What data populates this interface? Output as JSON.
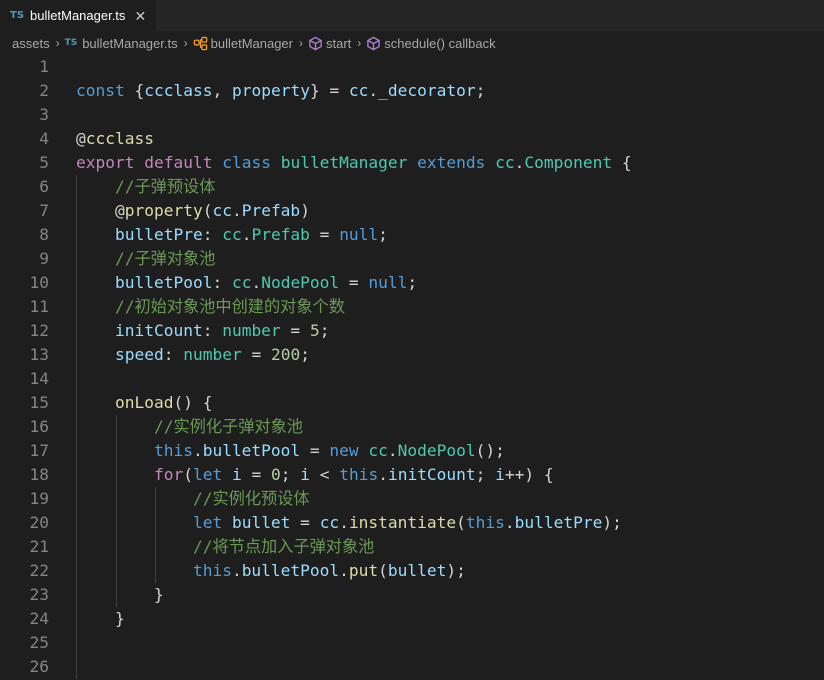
{
  "tab": {
    "badge": "TS",
    "label": "bulletManager.ts",
    "close": "✕"
  },
  "breadcrumb": {
    "folder": "assets",
    "file_badge": "TS",
    "file": "bulletManager.ts",
    "class_name": "bulletManager",
    "method": "start",
    "callback": "schedule() callback",
    "separator": "›"
  },
  "colors": {
    "background": "#1e1e1e",
    "tabbar": "#252526",
    "keyword": "#569cd6",
    "control": "#c586c0",
    "variable": "#9cdcfe",
    "type": "#4ec9b0",
    "function": "#dcdcaa",
    "number": "#b5cea8",
    "comment": "#6a9955",
    "line_number": "#858585",
    "ts_badge": "#519aba"
  },
  "icons": {
    "class_icon": "symbol-class-icon",
    "method_icon": "symbol-method-icon",
    "close_icon": "close-icon"
  },
  "lines": [
    {
      "n": "1",
      "tokens": []
    },
    {
      "n": "2",
      "tokens": [
        [
          "kw",
          "const"
        ],
        [
          "pl",
          " {"
        ],
        [
          "var",
          "ccclass"
        ],
        [
          "pl",
          ", "
        ],
        [
          "var",
          "property"
        ],
        [
          "pl",
          "} = "
        ],
        [
          "var",
          "cc"
        ],
        [
          "pl",
          "."
        ],
        [
          "var",
          "_decorator"
        ],
        [
          "pl",
          ";"
        ]
      ]
    },
    {
      "n": "3",
      "tokens": []
    },
    {
      "n": "4",
      "tokens": [
        [
          "pl",
          "@"
        ],
        [
          "fn",
          "ccclass"
        ]
      ]
    },
    {
      "n": "5",
      "tokens": [
        [
          "ctl",
          "export"
        ],
        [
          "pl",
          " "
        ],
        [
          "ctl",
          "default"
        ],
        [
          "pl",
          " "
        ],
        [
          "kw",
          "class"
        ],
        [
          "pl",
          " "
        ],
        [
          "type",
          "bulletManager"
        ],
        [
          "pl",
          " "
        ],
        [
          "kw",
          "extends"
        ],
        [
          "pl",
          " "
        ],
        [
          "type",
          "cc"
        ],
        [
          "pl",
          "."
        ],
        [
          "type",
          "Component"
        ],
        [
          "pl",
          " {"
        ]
      ]
    },
    {
      "n": "6",
      "tokens": [
        [
          "pl",
          "    "
        ],
        [
          "cm",
          "//子弹预设体"
        ]
      ]
    },
    {
      "n": "7",
      "tokens": [
        [
          "pl",
          "    @"
        ],
        [
          "fn",
          "property"
        ],
        [
          "pl",
          "("
        ],
        [
          "var",
          "cc"
        ],
        [
          "pl",
          "."
        ],
        [
          "var",
          "Prefab"
        ],
        [
          "pl",
          ")"
        ]
      ]
    },
    {
      "n": "8",
      "tokens": [
        [
          "pl",
          "    "
        ],
        [
          "var",
          "bulletPre"
        ],
        [
          "pl",
          ": "
        ],
        [
          "type",
          "cc"
        ],
        [
          "pl",
          "."
        ],
        [
          "type",
          "Prefab"
        ],
        [
          "pl",
          " = "
        ],
        [
          "kw",
          "null"
        ],
        [
          "pl",
          ";"
        ]
      ]
    },
    {
      "n": "9",
      "tokens": [
        [
          "pl",
          "    "
        ],
        [
          "cm",
          "//子弹对象池"
        ]
      ]
    },
    {
      "n": "10",
      "tokens": [
        [
          "pl",
          "    "
        ],
        [
          "var",
          "bulletPool"
        ],
        [
          "pl",
          ": "
        ],
        [
          "type",
          "cc"
        ],
        [
          "pl",
          "."
        ],
        [
          "type",
          "NodePool"
        ],
        [
          "pl",
          " = "
        ],
        [
          "kw",
          "null"
        ],
        [
          "pl",
          ";"
        ]
      ]
    },
    {
      "n": "11",
      "tokens": [
        [
          "pl",
          "    "
        ],
        [
          "cm",
          "//初始对象池中创建的对象个数"
        ]
      ]
    },
    {
      "n": "12",
      "tokens": [
        [
          "pl",
          "    "
        ],
        [
          "var",
          "initCount"
        ],
        [
          "pl",
          ": "
        ],
        [
          "type",
          "number"
        ],
        [
          "pl",
          " = "
        ],
        [
          "num",
          "5"
        ],
        [
          "pl",
          ";"
        ]
      ]
    },
    {
      "n": "13",
      "tokens": [
        [
          "pl",
          "    "
        ],
        [
          "var",
          "speed"
        ],
        [
          "pl",
          ": "
        ],
        [
          "type",
          "number"
        ],
        [
          "pl",
          " = "
        ],
        [
          "num",
          "200"
        ],
        [
          "pl",
          ";"
        ]
      ]
    },
    {
      "n": "14",
      "tokens": []
    },
    {
      "n": "15",
      "tokens": [
        [
          "pl",
          "    "
        ],
        [
          "fn",
          "onLoad"
        ],
        [
          "pl",
          "() {"
        ]
      ]
    },
    {
      "n": "16",
      "tokens": [
        [
          "pl",
          "        "
        ],
        [
          "cm",
          "//实例化子弹对象池"
        ]
      ]
    },
    {
      "n": "17",
      "tokens": [
        [
          "pl",
          "        "
        ],
        [
          "kw",
          "this"
        ],
        [
          "pl",
          "."
        ],
        [
          "var",
          "bulletPool"
        ],
        [
          "pl",
          " = "
        ],
        [
          "kw",
          "new"
        ],
        [
          "pl",
          " "
        ],
        [
          "type",
          "cc"
        ],
        [
          "pl",
          "."
        ],
        [
          "type",
          "NodePool"
        ],
        [
          "pl",
          "();"
        ]
      ]
    },
    {
      "n": "18",
      "tokens": [
        [
          "pl",
          "        "
        ],
        [
          "ctl",
          "for"
        ],
        [
          "pl",
          "("
        ],
        [
          "kw",
          "let"
        ],
        [
          "pl",
          " "
        ],
        [
          "var",
          "i"
        ],
        [
          "pl",
          " = "
        ],
        [
          "num",
          "0"
        ],
        [
          "pl",
          "; "
        ],
        [
          "var",
          "i"
        ],
        [
          "pl",
          " < "
        ],
        [
          "kw",
          "this"
        ],
        [
          "pl",
          "."
        ],
        [
          "var",
          "initCount"
        ],
        [
          "pl",
          "; "
        ],
        [
          "var",
          "i"
        ],
        [
          "pl",
          "++) {"
        ]
      ]
    },
    {
      "n": "19",
      "tokens": [
        [
          "pl",
          "            "
        ],
        [
          "cm",
          "//实例化预设体"
        ]
      ]
    },
    {
      "n": "20",
      "tokens": [
        [
          "pl",
          "            "
        ],
        [
          "kw",
          "let"
        ],
        [
          "pl",
          " "
        ],
        [
          "var",
          "bullet"
        ],
        [
          "pl",
          " = "
        ],
        [
          "var",
          "cc"
        ],
        [
          "pl",
          "."
        ],
        [
          "fn",
          "instantiate"
        ],
        [
          "pl",
          "("
        ],
        [
          "kw",
          "this"
        ],
        [
          "pl",
          "."
        ],
        [
          "var",
          "bulletPre"
        ],
        [
          "pl",
          ");"
        ]
      ]
    },
    {
      "n": "21",
      "tokens": [
        [
          "pl",
          "            "
        ],
        [
          "cm",
          "//将节点加入子弹对象池"
        ]
      ]
    },
    {
      "n": "22",
      "tokens": [
        [
          "pl",
          "            "
        ],
        [
          "kw",
          "this"
        ],
        [
          "pl",
          "."
        ],
        [
          "var",
          "bulletPool"
        ],
        [
          "pl",
          "."
        ],
        [
          "fn",
          "put"
        ],
        [
          "pl",
          "("
        ],
        [
          "var",
          "bullet"
        ],
        [
          "pl",
          ");"
        ]
      ]
    },
    {
      "n": "23",
      "tokens": [
        [
          "pl",
          "        }"
        ]
      ]
    },
    {
      "n": "24",
      "tokens": [
        [
          "pl",
          "    }"
        ]
      ]
    },
    {
      "n": "25",
      "tokens": []
    },
    {
      "n": "26",
      "tokens": []
    }
  ]
}
